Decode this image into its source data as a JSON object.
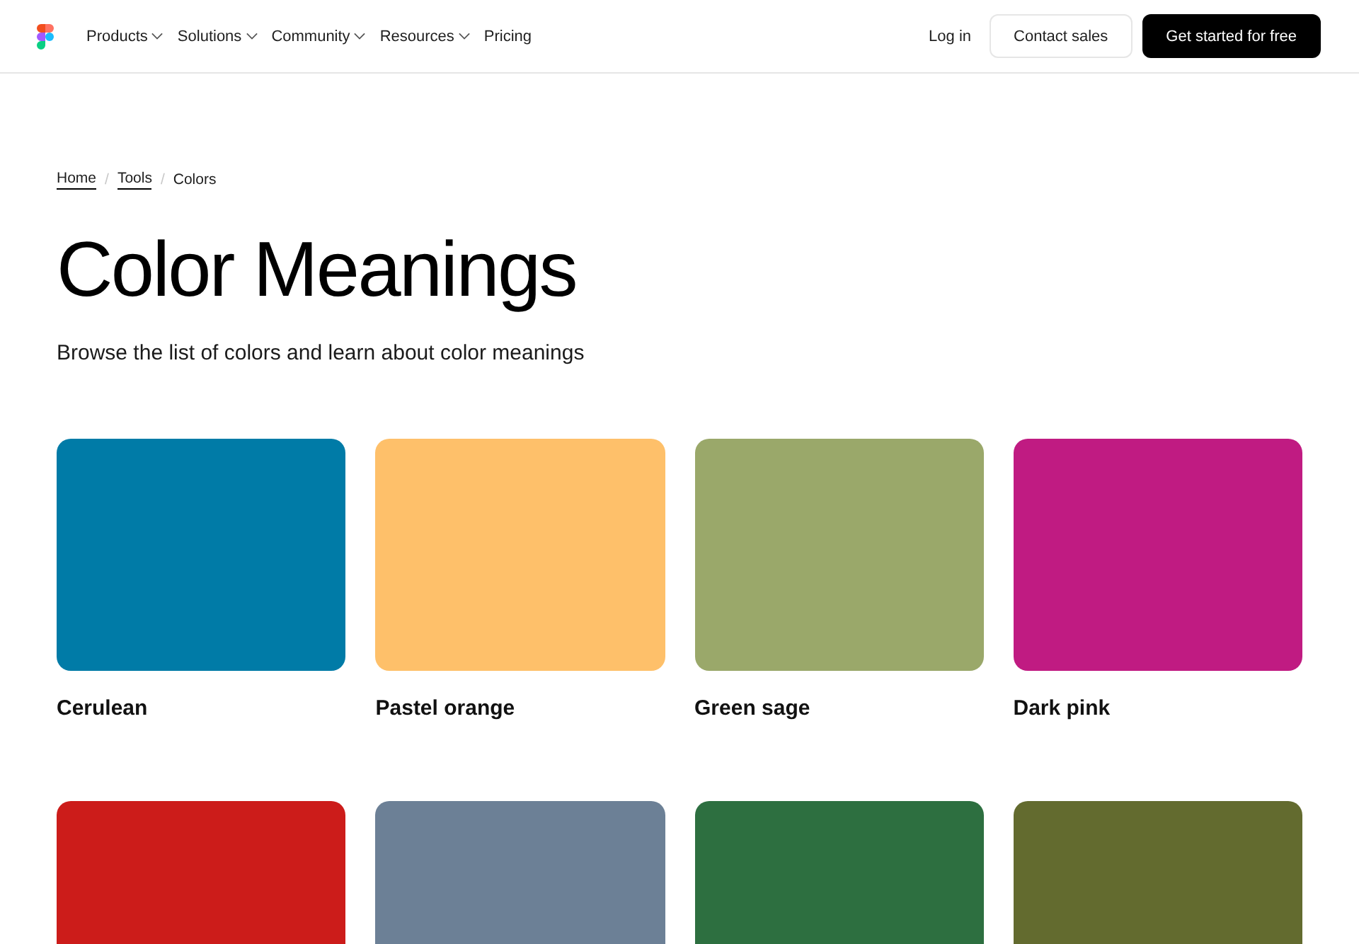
{
  "header": {
    "nav": [
      {
        "label": "Products",
        "kind": "dropdown"
      },
      {
        "label": "Solutions",
        "kind": "dropdown"
      },
      {
        "label": "Community",
        "kind": "dropdown"
      },
      {
        "label": "Resources",
        "kind": "dropdown"
      },
      {
        "label": "Pricing",
        "kind": "link"
      }
    ],
    "actions": [
      {
        "label": "Log in",
        "kind": "link"
      },
      {
        "label": "Contact sales",
        "kind": "outline"
      },
      {
        "label": "Get started for free",
        "kind": "primary"
      }
    ]
  },
  "breadcrumb": {
    "separator": "/",
    "items": [
      {
        "label": "Home",
        "current": false
      },
      {
        "label": "Tools",
        "current": false
      },
      {
        "label": "Colors",
        "current": true
      }
    ]
  },
  "title": "Color Meanings",
  "subtitle": "Browse the list of colors and learn about color meanings",
  "colors": [
    {
      "name": "Cerulean",
      "color": "#007ba7"
    },
    {
      "name": "Pastel orange",
      "color": "#fec06a"
    },
    {
      "name": "Green sage",
      "color": "#9aa86a"
    },
    {
      "name": "Dark pink",
      "color": "#c01b82"
    },
    {
      "color": "#cc1c1a"
    },
    {
      "color": "#6c8096"
    },
    {
      "color": "#2d6f40"
    },
    {
      "color": "#636b2f"
    }
  ]
}
